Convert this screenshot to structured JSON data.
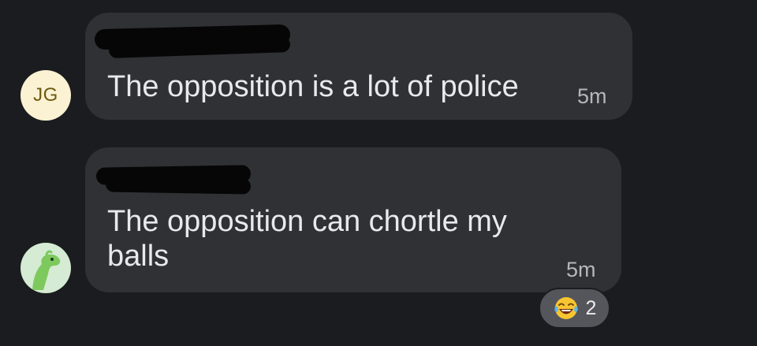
{
  "messages": [
    {
      "avatar": {
        "initials": "JG"
      },
      "text": "The opposition is a lot of police",
      "time": "5m"
    },
    {
      "avatar": {
        "icon": "dinosaur-avatar-icon"
      },
      "text": "The opposition can chortle my\nballs",
      "time": "5m",
      "reaction": {
        "emoji": "tears-of-joy-emoji",
        "count": "2"
      }
    }
  ],
  "colors": {
    "background": "#1b1c20",
    "bubble": "#303134",
    "text": "#e9e9ec",
    "timestamp": "#b6b7ba",
    "reaction_pill": "#54565b",
    "avatar_jg_bg": "#fbf2d3",
    "avatar_dino_bg": "#d5ebd3",
    "dino": "#7dc95e",
    "redaction": "#060606"
  }
}
